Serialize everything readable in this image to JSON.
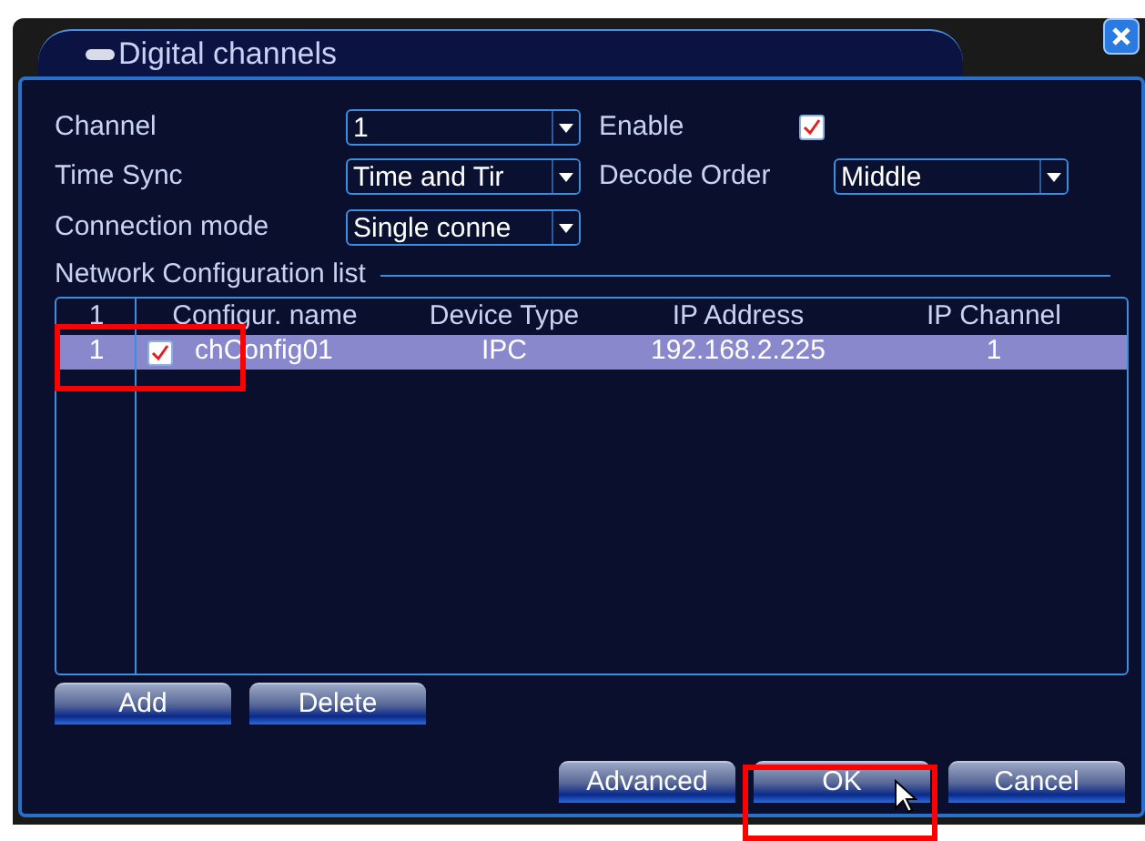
{
  "window": {
    "title": "Digital channels"
  },
  "fields": [
    {
      "label": "Channel",
      "value": "1",
      "kind": "select"
    },
    {
      "label": "Enable",
      "checked": true,
      "kind": "checkbox"
    },
    {
      "label": "Time Sync",
      "value": "Time and Tir",
      "kind": "select"
    },
    {
      "label": "Decode Order",
      "value": "Middle",
      "kind": "select"
    },
    {
      "label": "Connection mode",
      "value": "Single conne",
      "kind": "select"
    }
  ],
  "list": {
    "title": "Network Configuration list",
    "columns": [
      "1",
      "Configur. name",
      "Device Type",
      "IP Address",
      "IP Channel"
    ],
    "rows": [
      {
        "index": "1",
        "checked": true,
        "name": "chConfig01",
        "device_type": "IPC",
        "ip_address": "192.168.2.225",
        "ip_channel": "1",
        "selected": true
      }
    ]
  },
  "list_buttons": [
    "Add",
    "Delete"
  ],
  "buttons": [
    "Advanced",
    "OK",
    "Cancel"
  ]
}
